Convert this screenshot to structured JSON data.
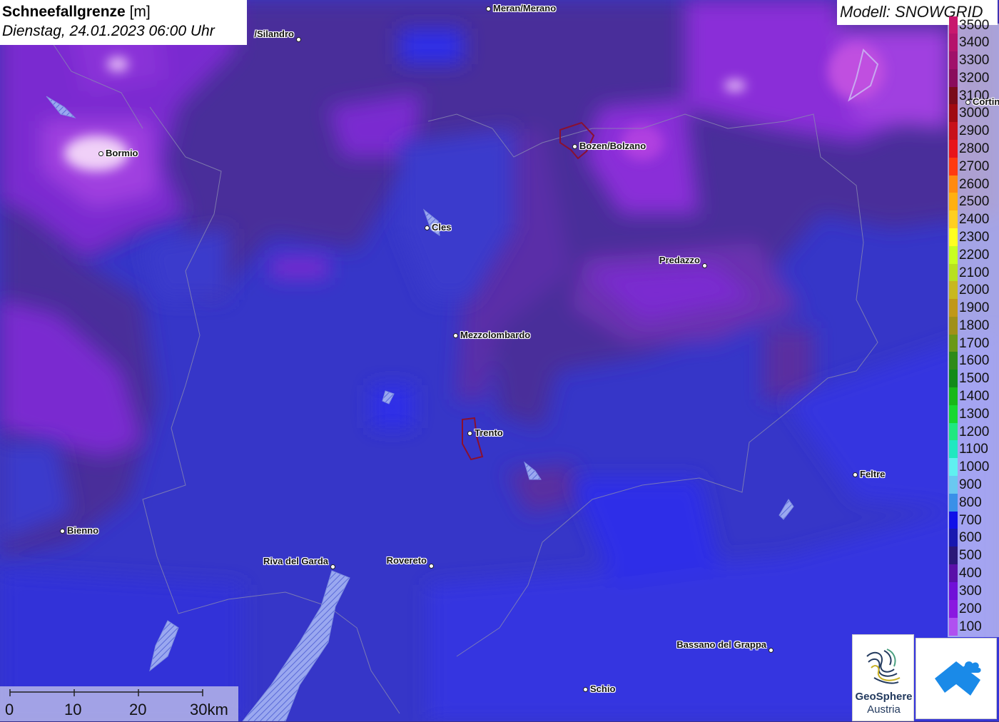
{
  "title": {
    "main_bold": "Schneefallgrenze",
    "main_unit": "[m]",
    "subtitle": "Dienstag, 24.01.2023 06:00 Uhr"
  },
  "model": {
    "label": "Modell: SNOWGRID"
  },
  "legend": {
    "items": [
      {
        "label": "3500",
        "color": "#c8186e"
      },
      {
        "label": "3400",
        "color": "#b5136b"
      },
      {
        "label": "3300",
        "color": "#a0106a"
      },
      {
        "label": "3200",
        "color": "#8a0c5c"
      },
      {
        "label": "3100",
        "color": "#7a0b1a"
      },
      {
        "label": "3000",
        "color": "#a00a12"
      },
      {
        "label": "2900",
        "color": "#c8101a"
      },
      {
        "label": "2800",
        "color": "#e8141a"
      },
      {
        "label": "2700",
        "color": "#ff3a10"
      },
      {
        "label": "2600",
        "color": "#ff8a10"
      },
      {
        "label": "2500",
        "color": "#ffb010"
      },
      {
        "label": "2400",
        "color": "#ffcf20"
      },
      {
        "label": "2300",
        "color": "#ffff20"
      },
      {
        "label": "2200",
        "color": "#c8ff20"
      },
      {
        "label": "2100",
        "color": "#b8e020"
      },
      {
        "label": "2000",
        "color": "#c8b820"
      },
      {
        "label": "1900",
        "color": "#c09818"
      },
      {
        "label": "1800",
        "color": "#a09018"
      },
      {
        "label": "1700",
        "color": "#6a9818"
      },
      {
        "label": "1600",
        "color": "#2e8a18"
      },
      {
        "label": "1500",
        "color": "#128a18"
      },
      {
        "label": "1400",
        "color": "#18b818"
      },
      {
        "label": "1300",
        "color": "#18d830"
      },
      {
        "label": "1200",
        "color": "#20e880"
      },
      {
        "label": "1100",
        "color": "#20e8c0"
      },
      {
        "label": "1000",
        "color": "#60f0f0"
      },
      {
        "label": "900",
        "color": "#6ac8f0"
      },
      {
        "label": "800",
        "color": "#3a90e8"
      },
      {
        "label": "700",
        "color": "#1010e8"
      },
      {
        "label": "600",
        "color": "#1818b0"
      },
      {
        "label": "500",
        "color": "#2a1878"
      },
      {
        "label": "400",
        "color": "#5a10a8"
      },
      {
        "label": "300",
        "color": "#7010d8"
      },
      {
        "label": "200",
        "color": "#8a18e0"
      },
      {
        "label": "100",
        "color": "#b050f0"
      }
    ]
  },
  "cities": [
    {
      "name": "Meran/Merano",
      "dot_side": "left"
    },
    {
      "name": "/Silandro",
      "dot_side": "right"
    },
    {
      "name": "Bormio",
      "dot_side": "left"
    },
    {
      "name": "Bozen/Bolzano",
      "dot_side": "left"
    },
    {
      "name": "Cles",
      "dot_side": "left"
    },
    {
      "name": "Predazzo",
      "dot_side": "right"
    },
    {
      "name": "Mezzolombardo",
      "dot_side": "left"
    },
    {
      "name": "Trento",
      "dot_side": "left"
    },
    {
      "name": "Feltre",
      "dot_side": "left"
    },
    {
      "name": "Bienno",
      "dot_side": "left"
    },
    {
      "name": "Riva del Garda",
      "dot_side": "right"
    },
    {
      "name": "Rovereto",
      "dot_side": "right"
    },
    {
      "name": "Bassano del Grappa",
      "dot_side": "right"
    },
    {
      "name": "Schio",
      "dot_side": "left"
    },
    {
      "name": "Cortina",
      "dot_side": "left"
    }
  ],
  "scalebar": {
    "labels": [
      "0",
      "10",
      "20",
      "30km"
    ]
  },
  "logos": {
    "geosphere_line1": "GeoSphere",
    "geosphere_line2": "Austria"
  },
  "colors": {
    "base_blue": "#3434d8",
    "deep_violet": "#5a2c9a",
    "purple": "#8a3ad8",
    "light_purple": "#b050f0",
    "magenta": "#c040d8",
    "pale": "#f0d8f8"
  }
}
